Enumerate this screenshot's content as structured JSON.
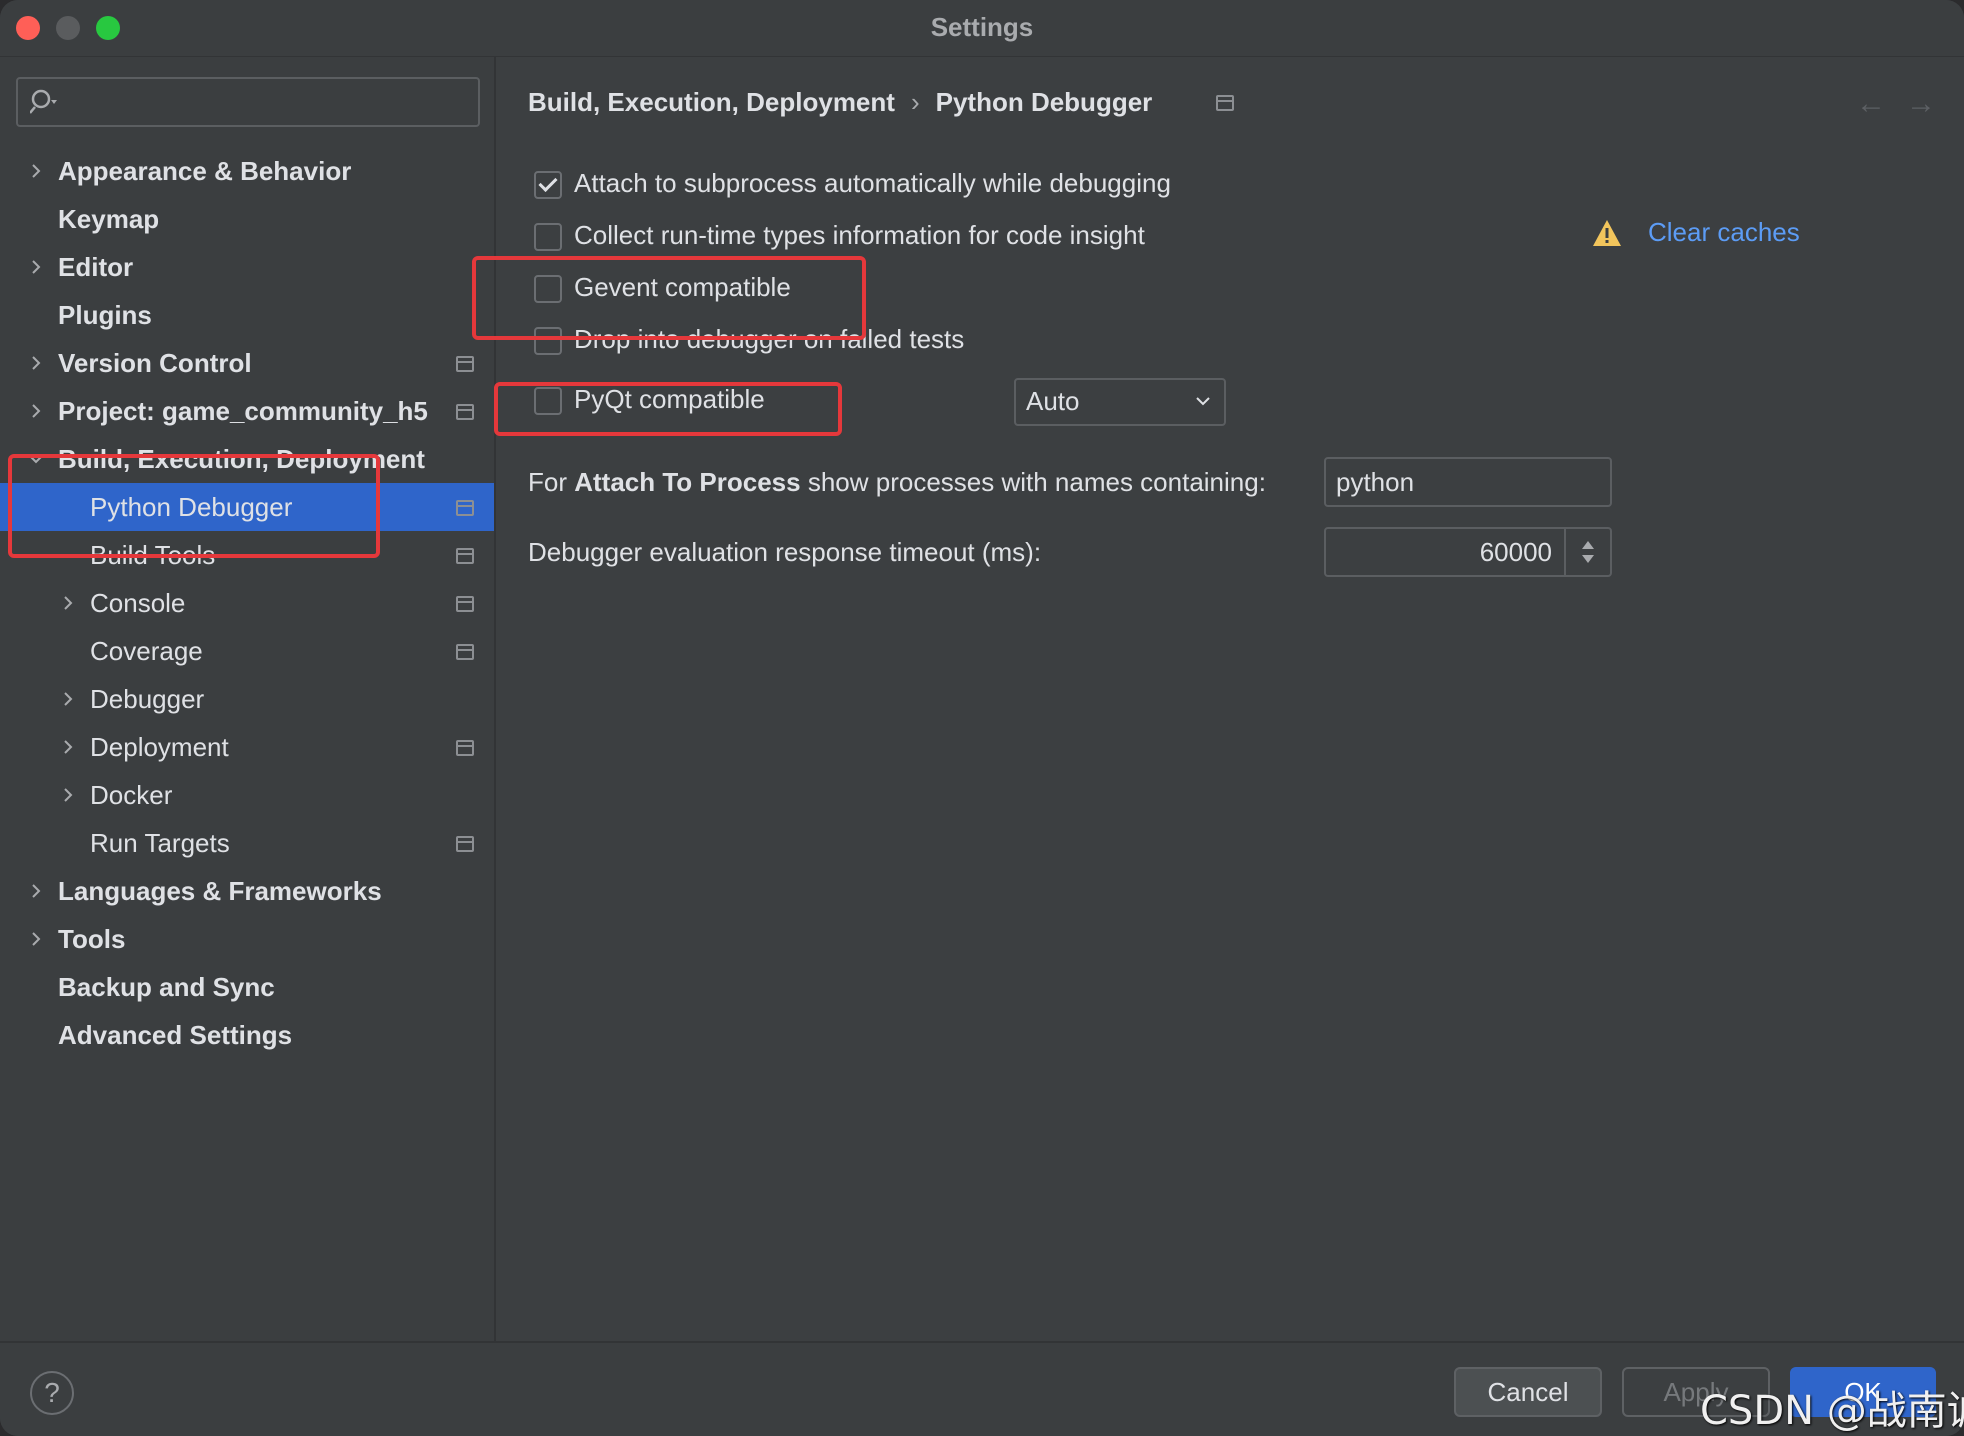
{
  "window": {
    "title": "Settings"
  },
  "search": {
    "placeholder": ""
  },
  "sidebar": {
    "items": [
      {
        "label": "Appearance & Behavior",
        "level": 0,
        "expandable": true,
        "shared": false
      },
      {
        "label": "Keymap",
        "level": 0,
        "expandable": false,
        "shared": false
      },
      {
        "label": "Editor",
        "level": 0,
        "expandable": true,
        "shared": false
      },
      {
        "label": "Plugins",
        "level": 0,
        "expandable": false,
        "shared": false
      },
      {
        "label": "Version Control",
        "level": 0,
        "expandable": true,
        "shared": true
      },
      {
        "label": "Project: game_community_h5",
        "level": 0,
        "expandable": true,
        "shared": true
      },
      {
        "label": "Build, Execution, Deployment",
        "level": 0,
        "expandable": true,
        "expanded": true,
        "shared": false
      },
      {
        "label": "Python Debugger",
        "level": 1,
        "expandable": false,
        "selected": true,
        "shared": true
      },
      {
        "label": "Build Tools",
        "level": 1,
        "expandable": false,
        "shared": true
      },
      {
        "label": "Console",
        "level": 1,
        "expandable": true,
        "shared": true
      },
      {
        "label": "Coverage",
        "level": 1,
        "expandable": false,
        "shared": true
      },
      {
        "label": "Debugger",
        "level": 1,
        "expandable": true,
        "shared": false
      },
      {
        "label": "Deployment",
        "level": 1,
        "expandable": true,
        "shared": true
      },
      {
        "label": "Docker",
        "level": 1,
        "expandable": true,
        "shared": false
      },
      {
        "label": "Run Targets",
        "level": 1,
        "expandable": false,
        "shared": true
      },
      {
        "label": "Languages & Frameworks",
        "level": 0,
        "expandable": true,
        "shared": false
      },
      {
        "label": "Tools",
        "level": 0,
        "expandable": true,
        "shared": false
      },
      {
        "label": "Backup and Sync",
        "level": 0,
        "expandable": false,
        "shared": false
      },
      {
        "label": "Advanced Settings",
        "level": 0,
        "expandable": false,
        "shared": false
      }
    ]
  },
  "breadcrumb": {
    "parent": "Build, Execution, Deployment",
    "current": "Python Debugger",
    "separator": "›"
  },
  "options": {
    "attach_subprocess": {
      "label": "Attach to subprocess automatically while debugging",
      "checked": true
    },
    "collect_runtime": {
      "label": "Collect run-time types information for code insight",
      "checked": false
    },
    "gevent": {
      "label": "Gevent compatible",
      "checked": false
    },
    "drop_into_debugger": {
      "label": "Drop into debugger on failed tests",
      "checked": false
    },
    "pyqt": {
      "label": "PyQt compatible",
      "checked": false
    }
  },
  "clear_caches": "Clear caches",
  "pyqt_mode": {
    "value": "Auto"
  },
  "attach_filter": {
    "label_prefix": "For ",
    "label_bold": "Attach To Process",
    "label_suffix": " show processes with names containing:",
    "value": "python"
  },
  "timeout": {
    "label": "Debugger evaluation response timeout (ms):",
    "value": "60000"
  },
  "footer": {
    "help": "?",
    "cancel": "Cancel",
    "apply": "Apply",
    "ok": "OK"
  },
  "watermark": "CSDN @战南诚",
  "colors": {
    "accent": "#2f65ca",
    "link": "#5c9cf5",
    "annotation": "#e5383b",
    "background": "#3c3f41"
  }
}
